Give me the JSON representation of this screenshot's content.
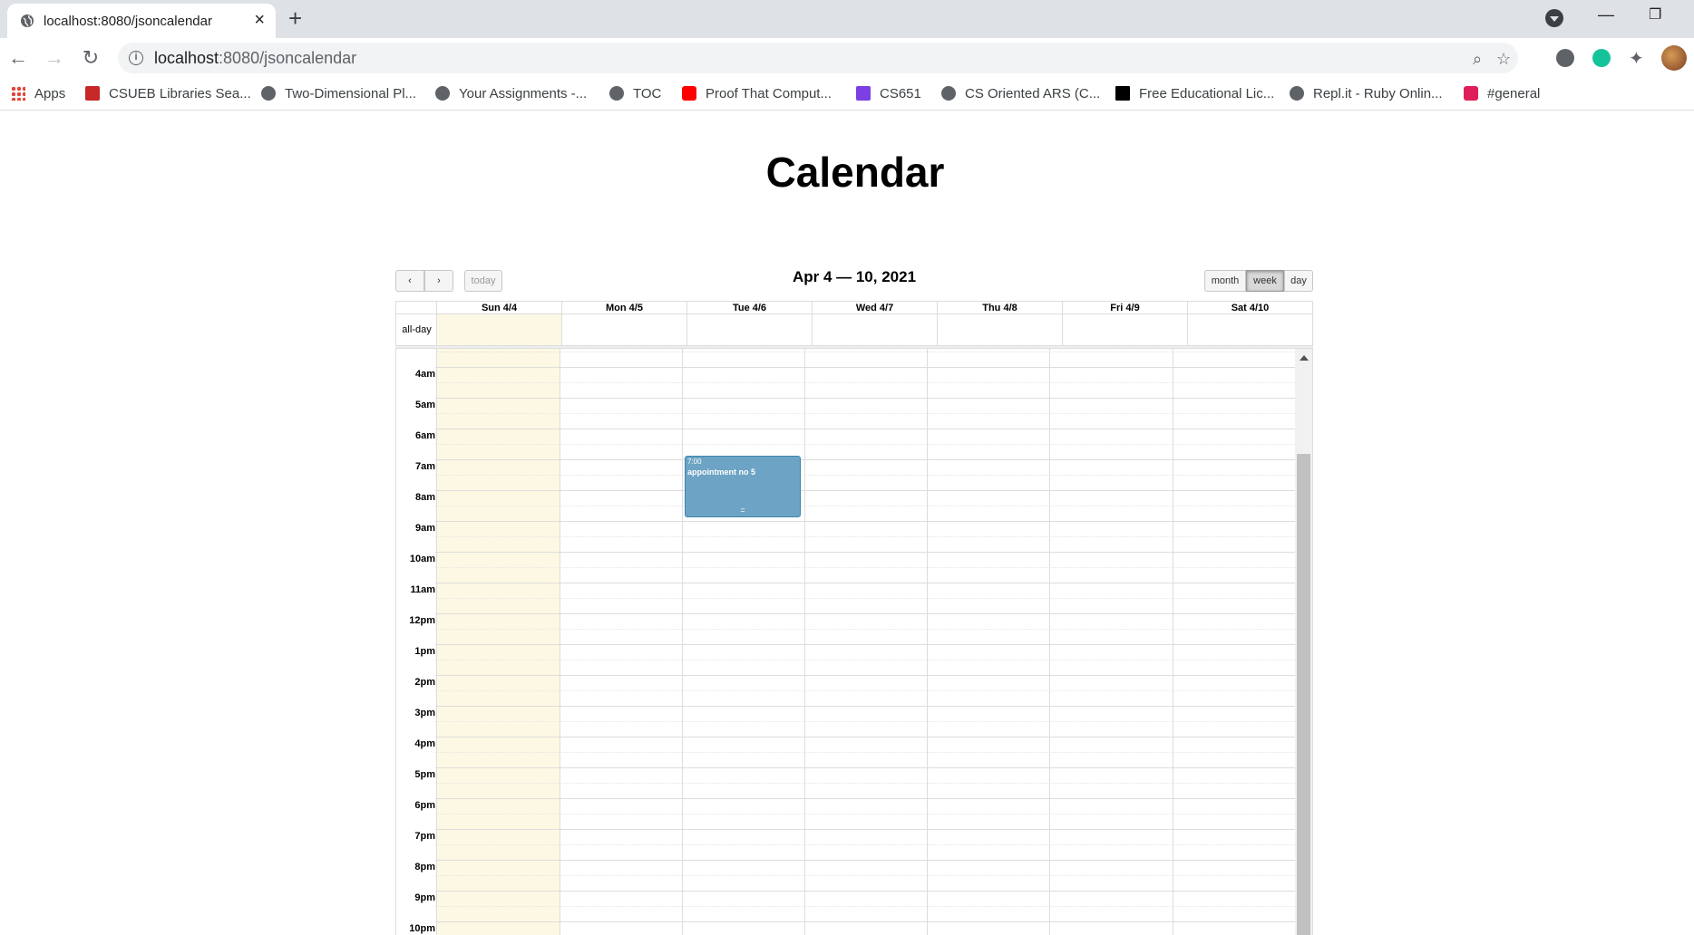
{
  "browser": {
    "tab_title": "localhost:8080/jsoncalendar",
    "url_host": "localhost",
    "url_path": ":8080/jsoncalendar",
    "bookmarks": [
      {
        "label": "Apps",
        "color": "#ea4335"
      },
      {
        "label": "CSUEB Libraries Sea...",
        "color": "#c62828"
      },
      {
        "label": "Two-Dimensional Pl...",
        "color": "#5f6368"
      },
      {
        "label": "Your Assignments -...",
        "color": "#5f6368"
      },
      {
        "label": "TOC",
        "color": "#5f6368"
      },
      {
        "label": "Proof That Comput...",
        "color": "#ff0000"
      },
      {
        "label": "CS651",
        "color": "#7b3fe4"
      },
      {
        "label": "CS Oriented ARS (C...",
        "color": "#5f6368"
      },
      {
        "label": "Free Educational Lic...",
        "color": "#000000"
      },
      {
        "label": "Repl.it - Ruby Onlin...",
        "color": "#5f6368"
      },
      {
        "label": "#general",
        "color": "#e01e5a"
      }
    ]
  },
  "page": {
    "title": "Calendar"
  },
  "calendar": {
    "title": "Apr 4 — 10, 2021",
    "today_label": "today",
    "views": [
      "month",
      "week",
      "day"
    ],
    "active_view": "week",
    "allday_label": "all-day",
    "days": [
      "Sun 4/4",
      "Mon 4/5",
      "Tue 4/6",
      "Wed 4/7",
      "Thu 4/8",
      "Fri 4/9",
      "Sat 4/10"
    ],
    "today_index": 0,
    "hours": [
      "4am",
      "5am",
      "6am",
      "7am",
      "8am",
      "9am",
      "10am",
      "11am",
      "12pm",
      "1pm",
      "2pm",
      "3pm",
      "4pm",
      "5pm",
      "6pm",
      "7pm",
      "8pm",
      "9pm",
      "10pm"
    ],
    "event": {
      "time": "7:00",
      "title": "appointment no 5",
      "day": "Tue 4/6",
      "resize_handle": "=",
      "color": "#6da3c4"
    },
    "today_color": "#fcf8e3"
  }
}
